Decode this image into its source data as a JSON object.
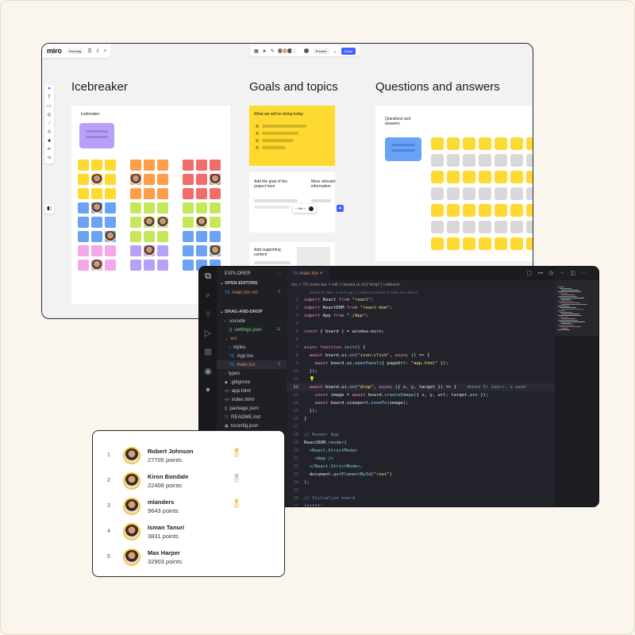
{
  "miro": {
    "logo": "miro",
    "board_name": "Planning",
    "present_label": "Present",
    "share_label": "Share",
    "zoom_label": "- 100% +",
    "frames": [
      {
        "title": "Icebreaker",
        "card_label": "Icebreaker"
      },
      {
        "title": "Goals and topics"
      },
      {
        "title": "Questions and answers",
        "card_label": "Questions and answers"
      }
    ],
    "goals": {
      "yellow_note": "What we will be doing today",
      "goal_note": "Add the goal of the project here",
      "info_note": "More relevant information",
      "support_note": "Add supporting content"
    }
  },
  "vscode": {
    "explorer_title": "EXPLORER",
    "open_editors": "OPEN EDITORS",
    "project": "DRAG-AND-DROP",
    "tab": "main.tsx",
    "breadcrumb": "src > TS main.tsx > init > board.ui.on(\"drop\") callback",
    "blame": "Ahmed El Sabri, a week ago | 2 authors (Ahmed El Sabri and others)",
    "inline_blame": "Ahmed El Sabri, a week",
    "files": [
      {
        "name": "main.tsx  src",
        "badge": "1",
        "color": "#e8875f",
        "indent": 1,
        "icon": "TS"
      },
      {
        "name": ".vscode",
        "badge": "",
        "color": "#c9c9d3",
        "indent": 1,
        "icon": "›"
      },
      {
        "name": "settings.json",
        "badge": "U",
        "color": "#7fd87f",
        "indent": 2,
        "icon": "{}"
      },
      {
        "name": "src",
        "badge": "",
        "color": "#e8875f",
        "indent": 1,
        "icon": "⌄"
      },
      {
        "name": "styles",
        "badge": "",
        "color": "#c9c9d3",
        "indent": 2,
        "icon": "›"
      },
      {
        "name": "App.tsx",
        "badge": "",
        "color": "#c9c9d3",
        "indent": 2,
        "icon": "TS"
      },
      {
        "name": "main.tsx",
        "badge": "1",
        "color": "#e8875f",
        "indent": 2,
        "icon": "TS"
      },
      {
        "name": "types",
        "badge": "",
        "color": "#c9c9d3",
        "indent": 1,
        "icon": "›"
      },
      {
        "name": ".gitignore",
        "badge": "",
        "color": "#c9c9d3",
        "indent": 1,
        "icon": "◆"
      },
      {
        "name": "app.html",
        "badge": "",
        "color": "#c9c9d3",
        "indent": 1,
        "icon": "<>"
      },
      {
        "name": "index.html",
        "badge": "",
        "color": "#c9c9d3",
        "indent": 1,
        "icon": "<>"
      },
      {
        "name": "package.json",
        "badge": "",
        "color": "#c9c9d3",
        "indent": 1,
        "icon": "{}"
      },
      {
        "name": "README.md",
        "badge": "",
        "color": "#c9c9d3",
        "indent": 1,
        "icon": "ⓘ"
      },
      {
        "name": "tsconfig.json",
        "badge": "",
        "color": "#c9c9d3",
        "indent": 1,
        "icon": "▦"
      },
      {
        "name": "vite.config.js",
        "badge": "",
        "color": "#c9c9d3",
        "indent": 1,
        "icon": "JS"
      }
    ]
  },
  "leaderboard": [
    {
      "rank": "1",
      "name": "Robert Johnson",
      "points": "27705 points",
      "medal": "gold"
    },
    {
      "rank": "2",
      "name": "Kiron Bondale",
      "points": "22408 points",
      "medal": "silver"
    },
    {
      "rank": "3",
      "name": "mlanders",
      "points": "9643 points",
      "medal": "gold"
    },
    {
      "rank": "4",
      "name": "Isman Tanuri",
      "points": "3831 points",
      "medal": ""
    },
    {
      "rank": "5",
      "name": "Max Harper",
      "points": "32903 points",
      "medal": ""
    }
  ],
  "colors": {
    "yellow": "#fed930",
    "orange": "#ff9d48",
    "red": "#f26c6c",
    "blue": "#6aa2f5",
    "green": "#c5e85a",
    "pink": "#f4a8e8",
    "purple": "#b7a0f7",
    "gray": "#d8d8d8",
    "miro_blue": "#4262ff"
  }
}
